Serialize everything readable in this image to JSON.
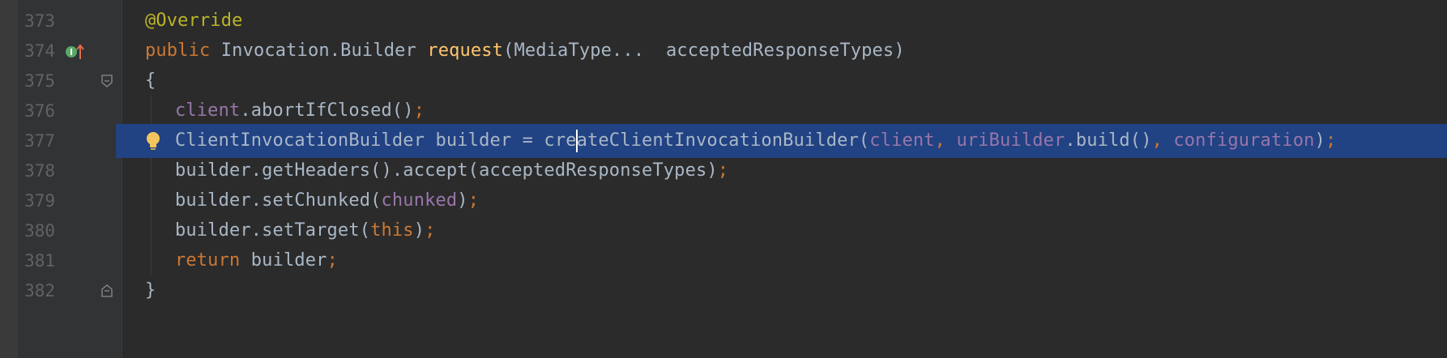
{
  "editor": {
    "colors": {
      "background": "#2b2b2b",
      "gutter": "#313335",
      "line_number": "#606366",
      "selection": "#214283",
      "keyword": "#cc7832",
      "annotation": "#bbb529",
      "field": "#9876aa",
      "method_declaration": "#ffc66d",
      "default": "#a9b7c6"
    },
    "lines": [
      {
        "number": "373",
        "segments": [
          {
            "t": "@Override",
            "c": "annotation"
          }
        ]
      },
      {
        "number": "374",
        "gutter_icon": "implements-method-icon",
        "segments": [
          {
            "t": "public ",
            "c": "keyword"
          },
          {
            "t": "Invocation.Builder ",
            "c": "plain"
          },
          {
            "t": "request",
            "c": "method-decl"
          },
          {
            "t": "(MediaType",
            "c": "plain"
          },
          {
            "t": "... ",
            "c": "plain"
          },
          {
            "t": " acceptedResponseTypes)",
            "c": "plain"
          }
        ]
      },
      {
        "number": "375",
        "gutter_icon": "fold-open-icon",
        "segments": [
          {
            "t": "{",
            "c": "plain"
          }
        ]
      },
      {
        "number": "376",
        "segments": [
          {
            "t": "client",
            "c": "field"
          },
          {
            "t": ".abortIfClosed()",
            "c": "plain"
          },
          {
            "t": ";",
            "c": "punct"
          }
        ]
      },
      {
        "number": "377",
        "highlight": true,
        "intention_icon": "lightbulb-icon",
        "segments": [
          {
            "t": "ClientInvocationBuilder builder = cre",
            "c": "plain"
          },
          {
            "t": "|",
            "c": "caret"
          },
          {
            "t": "ateClientInvocationBuilder(",
            "c": "plain"
          },
          {
            "t": "client",
            "c": "field"
          },
          {
            "t": ", ",
            "c": "punct"
          },
          {
            "t": "uriBuilder",
            "c": "field"
          },
          {
            "t": ".build()",
            "c": "plain"
          },
          {
            "t": ", ",
            "c": "punct"
          },
          {
            "t": "configuration",
            "c": "field"
          },
          {
            "t": ")",
            "c": "plain"
          },
          {
            "t": ";",
            "c": "punct"
          }
        ]
      },
      {
        "number": "378",
        "segments": [
          {
            "t": "builder.getHeaders().accept(acceptedResponseTypes)",
            "c": "plain"
          },
          {
            "t": ";",
            "c": "punct"
          }
        ]
      },
      {
        "number": "379",
        "segments": [
          {
            "t": "builder.setChunked(",
            "c": "plain"
          },
          {
            "t": "chunked",
            "c": "field"
          },
          {
            "t": ")",
            "c": "plain"
          },
          {
            "t": ";",
            "c": "punct"
          }
        ]
      },
      {
        "number": "380",
        "segments": [
          {
            "t": "builder.setTarget(",
            "c": "plain"
          },
          {
            "t": "this",
            "c": "keyword"
          },
          {
            "t": ")",
            "c": "plain"
          },
          {
            "t": ";",
            "c": "punct"
          }
        ]
      },
      {
        "number": "381",
        "segments": [
          {
            "t": "return ",
            "c": "keyword"
          },
          {
            "t": "builder",
            "c": "plain"
          },
          {
            "t": ";",
            "c": "punct"
          }
        ]
      },
      {
        "number": "382",
        "gutter_icon": "fold-close-icon",
        "segments": [
          {
            "t": "}",
            "c": "plain"
          }
        ]
      }
    ]
  }
}
